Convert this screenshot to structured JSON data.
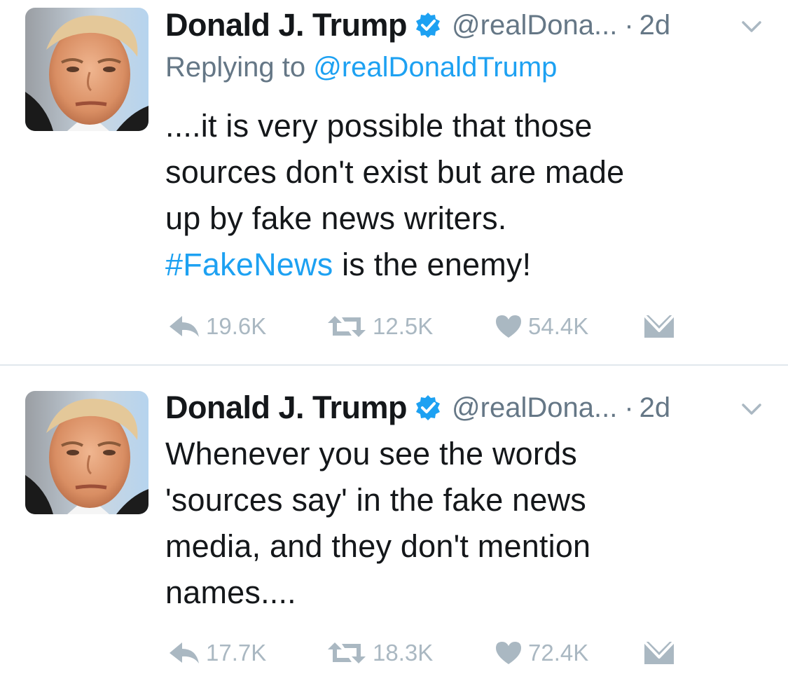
{
  "tweets": [
    {
      "author_name": "Donald J. Trump",
      "handle": "@realDona...",
      "separator": "·",
      "time": "2d",
      "replying_to_label": "Replying to",
      "replying_to_handle": "@realDonaldTrump",
      "text_lines": [
        "....it is very possible that those",
        "sources don't exist but are made",
        "up by fake news writers."
      ],
      "hashtag": "#FakeNews",
      "text_tail": " is the enemy!",
      "stats": {
        "replies": "19.6K",
        "retweets": "12.5K",
        "likes": "54.4K"
      }
    },
    {
      "author_name": "Donald J. Trump",
      "handle": "@realDona...",
      "separator": "·",
      "time": "2d",
      "text_lines": [
        "Whenever you see the words",
        "'sources say' in the fake news",
        "media, and they don't mention",
        "names...."
      ],
      "stats": {
        "replies": "17.7K",
        "retweets": "18.3K",
        "likes": "72.4K"
      }
    }
  ],
  "icons": {
    "verified": "verified-badge-icon",
    "chevron": "chevron-down-icon",
    "reply": "reply-icon",
    "retweet": "retweet-icon",
    "like": "heart-icon",
    "dm": "envelope-icon"
  },
  "colors": {
    "link": "#1da1f2",
    "muted": "#657786",
    "action": "#aab8c2",
    "text": "#14171a"
  }
}
